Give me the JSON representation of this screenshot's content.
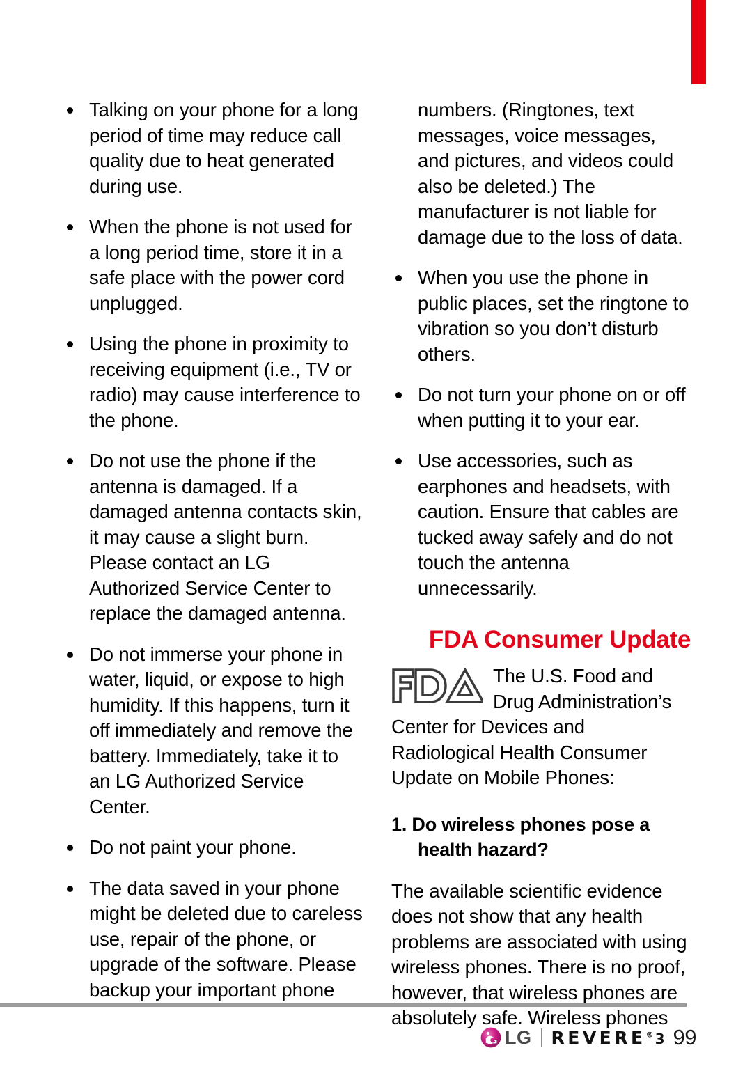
{
  "page": {
    "number": "99",
    "accent_red": "#e60012",
    "heading_red": "#e1061c",
    "rule_gray": "#9b9b9b"
  },
  "left_column": {
    "bullets": [
      "Talking on your phone for a long period of time may reduce call quality due to heat generated during use.",
      "When the phone is not used for a long period time, store it in a safe place with the power cord unplugged.",
      "Using the phone in proximity to receiving equipment (i.e., TV or radio) may cause interference to the phone.",
      "Do not use the phone if the antenna is damaged. If a damaged antenna contacts skin, it may cause a slight burn. Please contact an LG Authorized Service Center to replace the damaged antenna.",
      "Do not immerse your phone in water, liquid, or expose to high humidity. If this happens, turn it off immediately and remove the battery. Immediately, take it to an LG Authorized Service Center.",
      "Do not paint your phone.",
      "The data saved in your phone might be deleted due to careless use, repair of the phone, or upgrade of the software. Please backup your important phone"
    ]
  },
  "right_column": {
    "continuation": "numbers. (Ringtones, text messages, voice messages, and pictures, and videos could also be deleted.) The manufacturer is not liable for damage due to the loss of data.",
    "bullets": [
      "When you use the phone in public places, set the ringtone to vibration so you don’t disturb others.",
      "Do not turn your phone on or off when putting it to your ear.",
      "Use accessories, such as earphones and headsets, with caution. Ensure that cables are tucked away safely and do not touch the antenna unnecessarily."
    ],
    "fda": {
      "heading": "FDA Consumer Update",
      "logo_alt": "fda-logo",
      "intro": "The U.S. Food and Drug Administration’s Center for Devices and Radiological Health Consumer Update on Mobile Phones:",
      "question": "1. Do wireless phones pose a health hazard?",
      "answer": "The available scientific evidence does not show that any health problems are associated with using wireless phones. There is no proof, however, that wireless phones are absolutely safe. Wireless phones"
    }
  },
  "footer": {
    "lg_label": "LG",
    "revere_label": "REVERE",
    "revere_registered": "®",
    "revere_generation": "3",
    "page_number": "99"
  }
}
